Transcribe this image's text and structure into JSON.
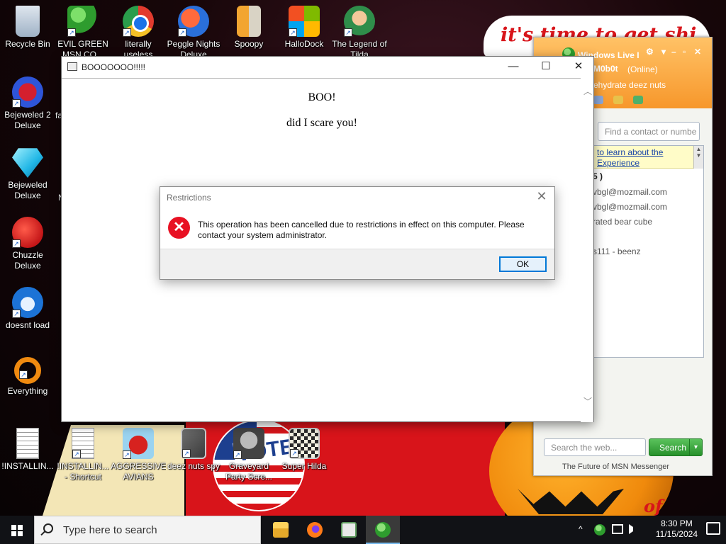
{
  "desktop": {
    "icons": [
      {
        "label": "Recycle Bin",
        "icon": "recycle-bin-icon"
      },
      {
        "label": "EVIL GREEN MSN CO...",
        "icon": "msn-messenger-icon"
      },
      {
        "label": "literally useless",
        "icon": "chrome-icon"
      },
      {
        "label": "Peggle Nights Deluxe",
        "icon": "peggle-icon"
      },
      {
        "label": "Spoopy",
        "icon": "book-icon"
      },
      {
        "label": "HalloDock",
        "icon": "windows-logo-icon"
      },
      {
        "label": "The Legend of Tilda",
        "icon": "legend-game-icon"
      },
      {
        "label": "Bejeweled 2 Deluxe",
        "icon": "bejeweled2-icon"
      },
      {
        "label": "Bejeweled Deluxe",
        "icon": "bejeweled-icon"
      },
      {
        "label": "Chuzzle Deluxe",
        "icon": "chuzzle-icon"
      },
      {
        "label": "doesnt load",
        "icon": "thunderbird-icon"
      },
      {
        "label": "Everything",
        "icon": "everything-search-icon"
      },
      {
        "label": "!INSTALLIN...",
        "icon": "document-icon"
      },
      {
        "label": "!INSTALLIN... - Shortcut",
        "icon": "document-icon"
      },
      {
        "label": "AGGRESSIVE AVIANS",
        "icon": "angry-bird-icon"
      },
      {
        "label": "deez nuts spy",
        "icon": "windows-stack-icon"
      },
      {
        "label": "Graveyard Party Scre...",
        "icon": "graveyard-icon"
      },
      {
        "label": "Super Hilda",
        "icon": "pixel-game-icon"
      }
    ],
    "shortcut_glyph": "↗",
    "partial_labels": [
      "fa",
      "N"
    ]
  },
  "wallpaper": {
    "banner_text": "it's time to get shit",
    "sign_text": "VOTED",
    "bottom_fragment": "of"
  },
  "boo_window": {
    "title": "BOOOOOOO!!!!!",
    "heading": "BOO!",
    "text": "did I scare you!",
    "minimize": "—",
    "maximize": "☐",
    "close": "✕",
    "scroll_up": "︿",
    "scroll_down": "﹀"
  },
  "dialog": {
    "title": "Restrictions",
    "message": "This operation has been cancelled due to restrictions in effect on this computer. Please contact your system administrator.",
    "ok_label": "OK",
    "close": "✕",
    "error_glyph": "✕"
  },
  "msn": {
    "title": "Windows Live I",
    "display_name": "M0b0t",
    "status": "(Online)",
    "personal_message": "ehydrate deez nuts",
    "search_contact_placeholder": "Find a contact or numbe",
    "banner_line1": "to learn about the",
    "banner_line2": "Experience",
    "contacts": [
      "5 )",
      "vbgl@mozmail.com",
      "vbgl@mozmail.com",
      "rated bear cube",
      "s111 - beenz"
    ],
    "web_search_placeholder": "Search the web...",
    "search_button": "Search",
    "footer": "The Future of MSN Messenger"
  },
  "taskbar": {
    "search_placeholder": "Type here to search",
    "apps": [
      "file-explorer-icon",
      "firefox-icon",
      "app-window-icon",
      "msn-messenger-icon"
    ],
    "tray": [
      "^"
    ],
    "time": "8:30 PM",
    "date": "11/15/2024"
  }
}
